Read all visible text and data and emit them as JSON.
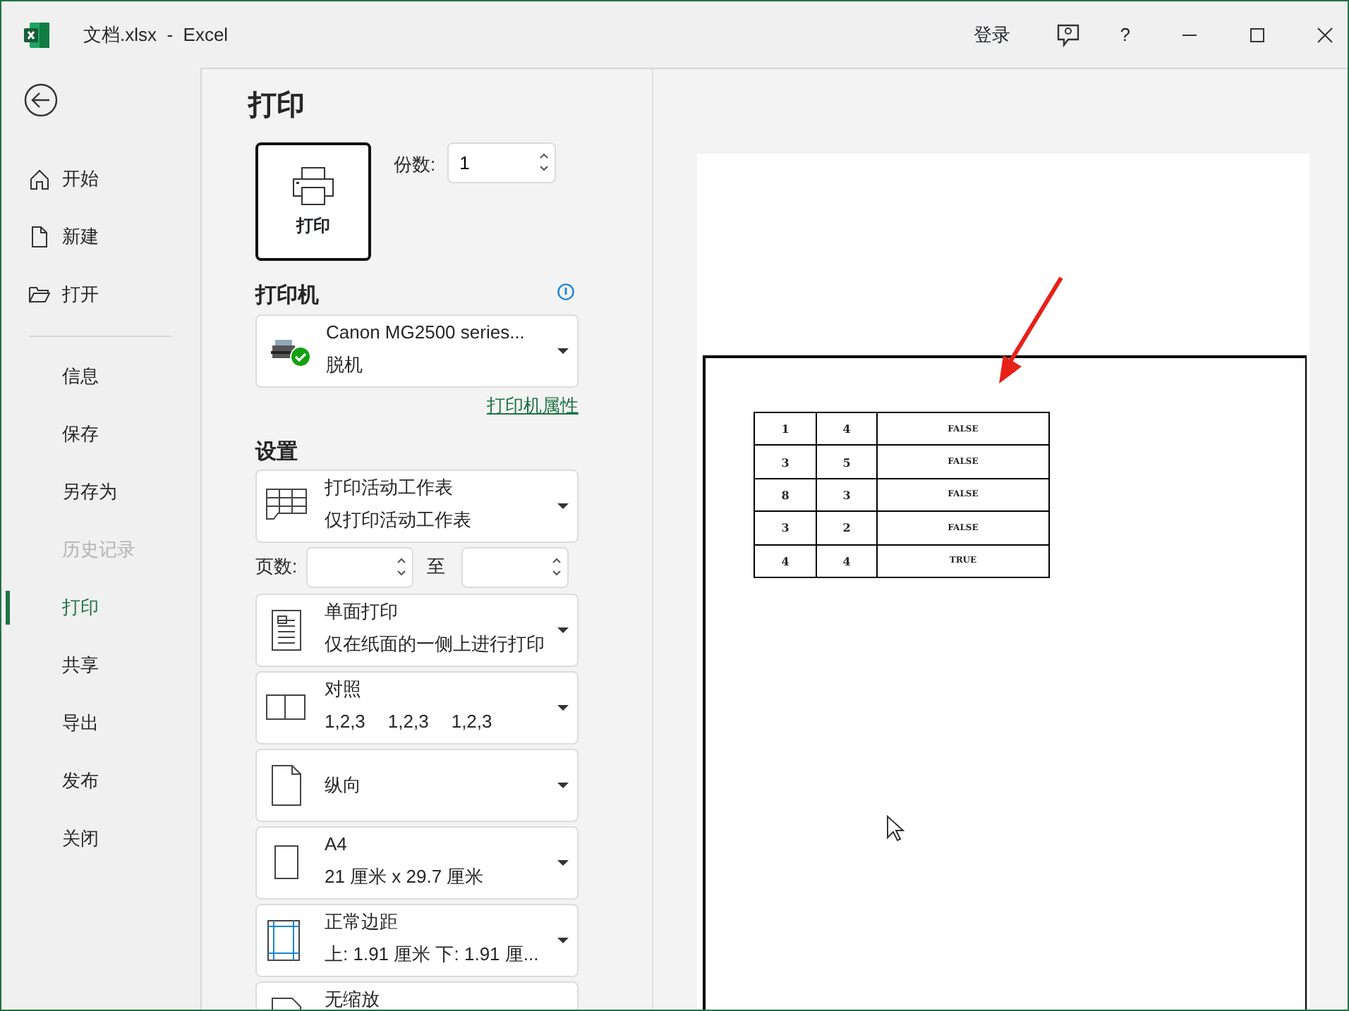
{
  "window": {
    "title": "文档.xlsx  -  Excel",
    "sign_in": "登录",
    "help": "?"
  },
  "sidebar": {
    "items": [
      {
        "label": "开始",
        "kind": "home",
        "selected": false,
        "disabled": false
      },
      {
        "label": "新建",
        "kind": "new",
        "selected": false,
        "disabled": false
      },
      {
        "label": "打开",
        "kind": "open",
        "selected": false,
        "disabled": false
      },
      {
        "label": "信息",
        "kind": "plain",
        "selected": false,
        "disabled": false
      },
      {
        "label": "保存",
        "kind": "plain",
        "selected": false,
        "disabled": false
      },
      {
        "label": "另存为",
        "kind": "plain",
        "selected": false,
        "disabled": false
      },
      {
        "label": "历史记录",
        "kind": "plain",
        "selected": false,
        "disabled": true
      },
      {
        "label": "打印",
        "kind": "plain",
        "selected": true,
        "disabled": false
      },
      {
        "label": "共享",
        "kind": "plain",
        "selected": false,
        "disabled": false
      },
      {
        "label": "导出",
        "kind": "plain",
        "selected": false,
        "disabled": false
      },
      {
        "label": "发布",
        "kind": "plain",
        "selected": false,
        "disabled": false
      },
      {
        "label": "关闭",
        "kind": "plain",
        "selected": false,
        "disabled": false
      }
    ]
  },
  "print": {
    "title": "打印",
    "button": "打印",
    "copies_label": "份数:",
    "copies": "1"
  },
  "printer": {
    "heading": "打印机",
    "name": "Canon MG2500 series...",
    "status": "脱机",
    "properties_link": "打印机属性"
  },
  "settings": {
    "heading": "设置",
    "options": [
      {
        "kind": "sheet",
        "title": "打印活动工作表",
        "detail": "仅打印活动工作表"
      },
      {
        "kind": "pages",
        "label": "页数:",
        "to_label": "至"
      },
      {
        "kind": "sides",
        "title": "单面打印",
        "detail": "仅在纸面的一侧上进行打印"
      },
      {
        "kind": "collate",
        "title": "对照",
        "parts": [
          "1,2,3",
          "1,2,3",
          "1,2,3"
        ]
      },
      {
        "kind": "orientation",
        "title": "纵向"
      },
      {
        "kind": "paper",
        "title": "A4",
        "detail": "21 厘米 x 29.7 厘米"
      },
      {
        "kind": "margins",
        "title": "正常边距",
        "detail": "上: 1.91 厘米 下: 1.91 厘..."
      },
      {
        "kind": "scaling",
        "title": "无缩放"
      }
    ]
  },
  "preview": {
    "rows": [
      [
        "1",
        "4",
        "FALSE"
      ],
      [
        "3",
        "5",
        "FALSE"
      ],
      [
        "8",
        "3",
        "FALSE"
      ],
      [
        "3",
        "2",
        "FALSE"
      ],
      [
        "4",
        "4",
        "TRUE"
      ]
    ]
  }
}
